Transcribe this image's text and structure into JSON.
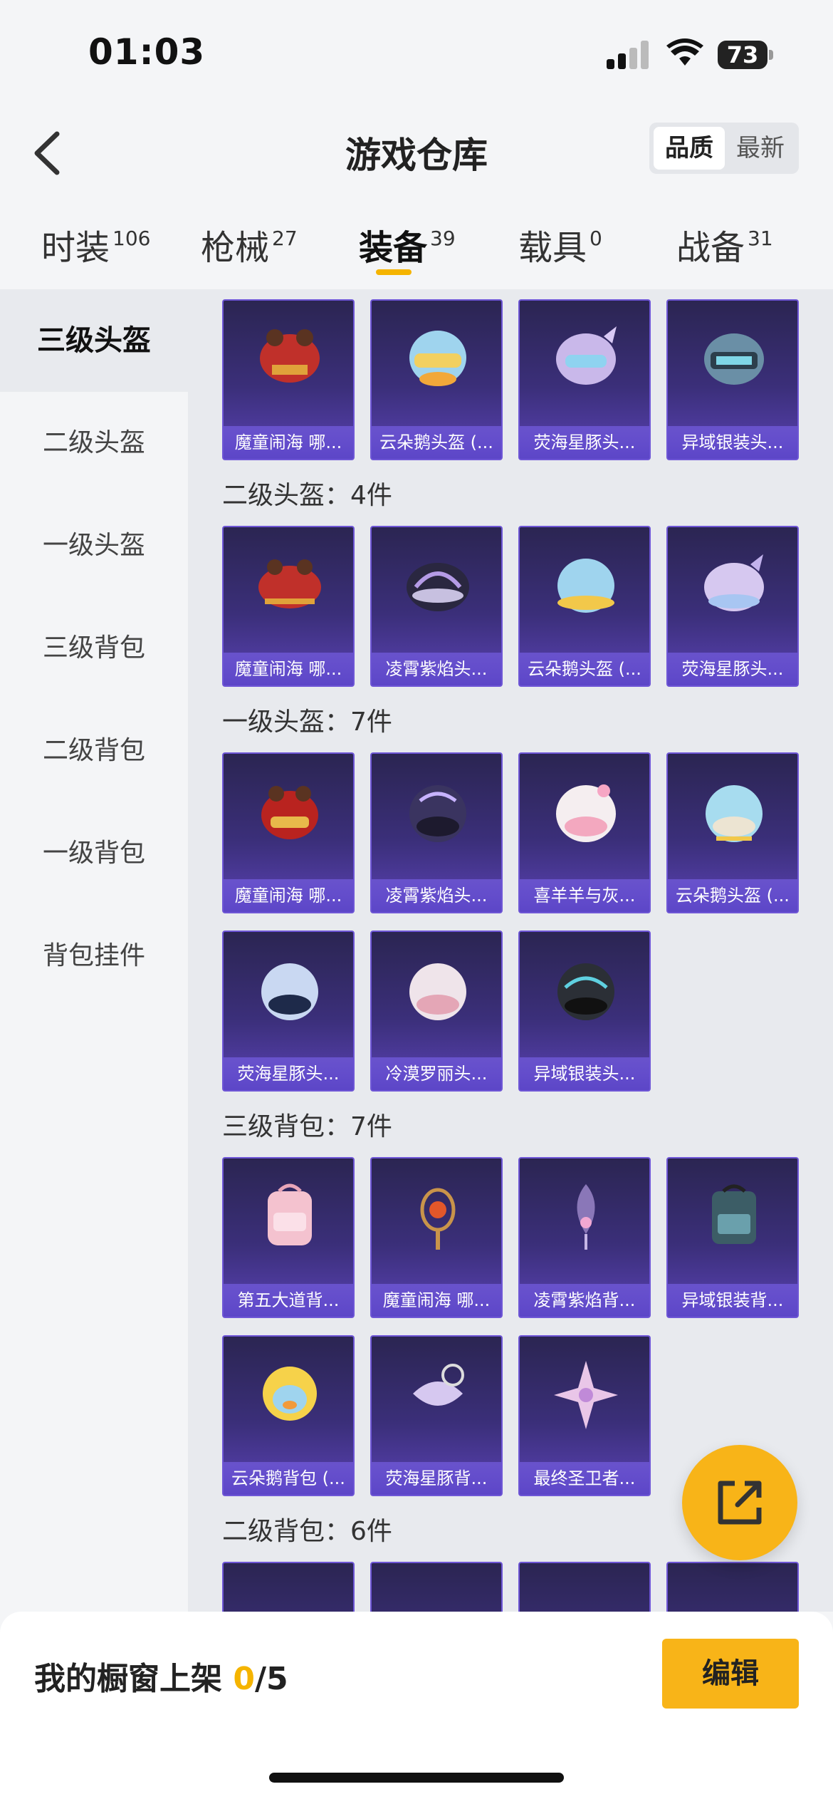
{
  "status": {
    "time": "01:03",
    "battery": "73"
  },
  "header": {
    "title": "游戏仓库",
    "sort": {
      "active": "品质",
      "inactive": "最新"
    }
  },
  "tabs": [
    {
      "label": "时装",
      "count": "106"
    },
    {
      "label": "枪械",
      "count": "27"
    },
    {
      "label": "装备",
      "count": "39"
    },
    {
      "label": "载具",
      "count": "0"
    },
    {
      "label": "战备",
      "count": "31"
    }
  ],
  "sidebar": {
    "items": [
      {
        "label": "三级头盔"
      },
      {
        "label": "二级头盔"
      },
      {
        "label": "一级头盔"
      },
      {
        "label": "三级背包"
      },
      {
        "label": "二级背包"
      },
      {
        "label": "一级背包"
      },
      {
        "label": "背包挂件"
      }
    ]
  },
  "sections": [
    {
      "title": "",
      "items": [
        "魔童闹海 哪...",
        "云朵鹅头盔 (...",
        "荧海星豚头...",
        "异域银装头..."
      ]
    },
    {
      "title": "二级头盔：4件",
      "items": [
        "魔童闹海 哪...",
        "凌霄紫焰头...",
        "云朵鹅头盔 (...",
        "荧海星豚头..."
      ]
    },
    {
      "title": "一级头盔：7件",
      "items": [
        "魔童闹海 哪...",
        "凌霄紫焰头...",
        "喜羊羊与灰...",
        "云朵鹅头盔 (...",
        "荧海星豚头...",
        "冷漠罗丽头...",
        "异域银装头..."
      ]
    },
    {
      "title": "三级背包：7件",
      "items": [
        "第五大道背...",
        "魔童闹海 哪...",
        "凌霄紫焰背...",
        "异域银装背...",
        "云朵鹅背包 (...",
        "荧海星豚背...",
        "最终圣卫者..."
      ]
    },
    {
      "title": "二级背包：6件",
      "items": [
        "",
        "",
        "",
        ""
      ]
    }
  ],
  "bottom": {
    "label_prefix": "我的橱窗上架 ",
    "used": "0",
    "total": "/5",
    "edit": "编辑"
  },
  "colors": {
    "accent": "#f8b418",
    "card_top": "#2b2552",
    "card_bottom": "#5a42b4"
  }
}
